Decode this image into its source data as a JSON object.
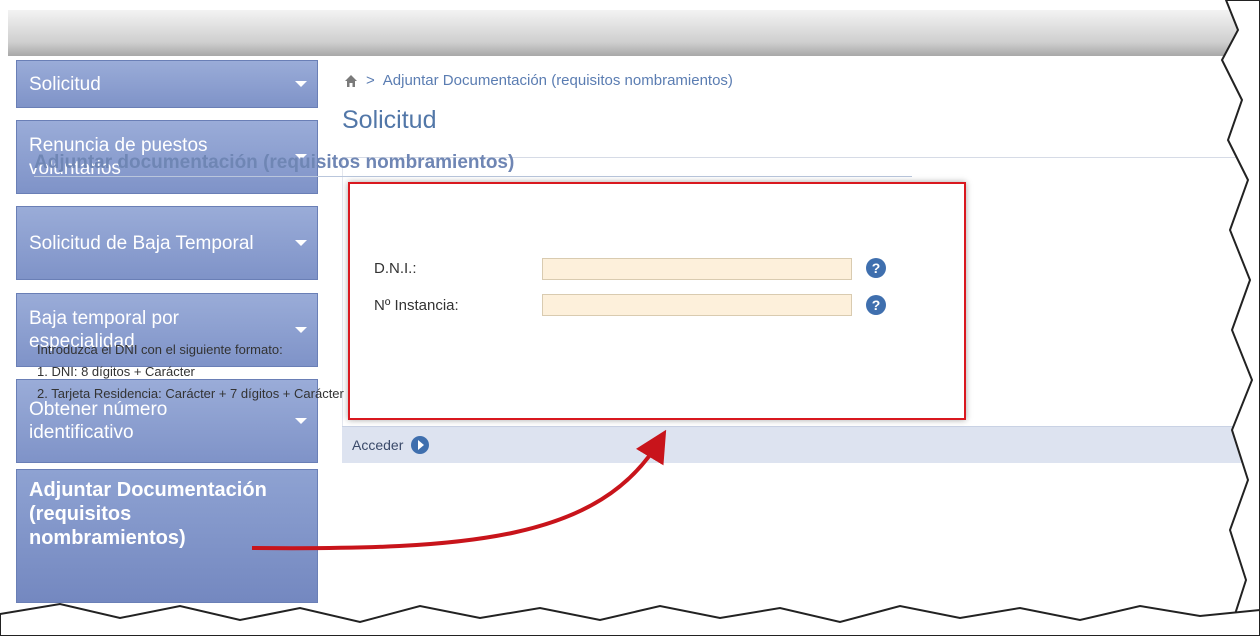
{
  "sidebar": {
    "items": [
      {
        "label": "Solicitud"
      },
      {
        "label": "Renuncia de puestos voluntarios"
      },
      {
        "label": "Solicitud de Baja Temporal"
      },
      {
        "label": "Baja temporal por especialidad"
      },
      {
        "label": "Obtener número identificativo"
      },
      {
        "label": "Adjuntar Documentación (requisitos nombramientos)"
      }
    ]
  },
  "breadcrumb": {
    "separator": ">",
    "current": "Adjuntar Documentación (requisitos nombramientos)"
  },
  "page_title": "Solicitud",
  "form": {
    "section_title": "Adjuntar documentación (requisitos nombramientos)",
    "dni_label": "D.N.I.:",
    "dni_value": "",
    "instancia_label": "Nº Instancia:",
    "instancia_value": "",
    "help_glyph": "?",
    "hint_intro": "Introduzca el DNI con el siguiente formato:",
    "hint_1": "1. DNI: 8 dígitos + Carácter",
    "hint_2": "2. Tarjeta Residencia: Carácter + 7 dígitos + Carácter",
    "submit_label": "Acceder"
  },
  "colors": {
    "sidebar": "#8a9ed0",
    "title": "#5277a8",
    "input_bg": "#fdf0db",
    "highlight": "#d9181f",
    "help": "#3f6fae"
  },
  "icons": [
    "home-icon",
    "chevron-down-icon",
    "help-icon",
    "arrow-right-circle-icon"
  ]
}
